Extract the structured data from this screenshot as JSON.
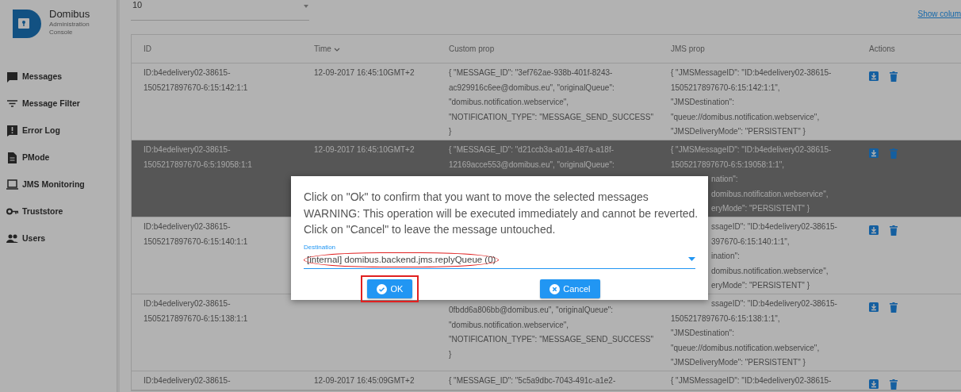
{
  "app": {
    "title": "Domibus",
    "subtitle_lines": [
      "Administration",
      "Console"
    ]
  },
  "sidebar": {
    "items": [
      {
        "label": "Messages",
        "kind": "chat"
      },
      {
        "label": "Message Filter",
        "kind": "filter"
      },
      {
        "label": "Error Log",
        "kind": "alert"
      },
      {
        "label": "PMode",
        "kind": "file"
      },
      {
        "label": "JMS Monitoring",
        "kind": "monitor"
      },
      {
        "label": "Truststore",
        "kind": "key"
      },
      {
        "label": "Users",
        "kind": "people"
      }
    ]
  },
  "page_size": {
    "value": "10"
  },
  "show_columns_link": "Show colum",
  "table": {
    "columns": [
      {
        "label": "ID",
        "sorted": false
      },
      {
        "label": "Time",
        "sorted": true
      },
      {
        "label": "Custom prop",
        "sorted": false
      },
      {
        "label": "JMS prop",
        "sorted": false
      },
      {
        "label": "Actions",
        "sorted": false
      }
    ],
    "rows": [
      {
        "selected": false,
        "id": [
          "ID:b4edelivery02-38615-",
          "1505217897670-6:15:142:1:1"
        ],
        "time": [
          "12-09-2017 16:45:10GMT+2"
        ],
        "custom": [
          "{ \"MESSAGE_ID\": \"3ef762ae-938b-401f-8243-",
          "ac929916c6ee@domibus.eu\", \"originalQueue\":",
          "\"domibus.notification.webservice\",",
          "\"NOTIFICATION_TYPE\": \"MESSAGE_SEND_SUCCESS\"",
          "}"
        ],
        "jms": [
          "{ \"JMSMessageID\": \"ID:b4edelivery02-38615-",
          "1505217897670-6:15:142:1:1\",",
          "\"JMSDestination\":",
          "\"queue://domibus.notification.webservice\",",
          "\"JMSDeliveryMode\": \"PERSISTENT\" }"
        ]
      },
      {
        "selected": true,
        "id": [
          "ID:b4edelivery02-38615-",
          "1505217897670-6:5:19058:1:1"
        ],
        "time": [
          "12-09-2017 16:45:10GMT+2"
        ],
        "custom": [
          "{ \"MESSAGE_ID\": \"d21ccb3a-a01a-487a-a18f-",
          "12169acce553@domibus.eu\", \"originalQueue\":"
        ],
        "jms": [
          "{ \"JMSMessageID\": \"ID:b4edelivery02-38615-",
          "1505217897670-6:5:19058:1:1\",",
          "nation\":",
          "domibus.notification.webservice\",",
          "eryMode\": \"PERSISTENT\" }"
        ]
      },
      {
        "selected": false,
        "id": [
          "ID:b4edelivery02-38615-",
          "1505217897670-6:15:140:1:1"
        ],
        "jms": [
          "ssageID\": \"ID:b4edelivery02-38615-",
          "397670-6:15:140:1:1\",",
          "ination\":",
          "domibus.notification.webservice\",",
          "eryMode\": \"PERSISTENT\" }"
        ]
      },
      {
        "selected": false,
        "id": [
          "ID:b4edelivery02-38615-",
          "1505217897670-6:15:138:1:1"
        ],
        "custom": [
          "0fbdd6a806bb@domibus.eu\", \"originalQueue\":",
          "\"domibus.notification.webservice\",",
          "\"NOTIFICATION_TYPE\": \"MESSAGE_SEND_SUCCESS\"",
          "}"
        ],
        "jms": [
          "ssageID\": \"ID:b4edelivery02-38615-",
          "1505217897670-6:15:138:1:1\",",
          "\"JMSDestination\":",
          "\"queue://domibus.notification.webservice\",",
          "\"JMSDeliveryMode\": \"PERSISTENT\" }"
        ]
      },
      {
        "selected": false,
        "id": [
          "ID:b4edelivery02-38615-"
        ],
        "time": [
          "12-09-2017 16:45:09GMT+2"
        ],
        "custom": [
          "{ \"MESSAGE_ID\": \"5c5a9dbc-7043-491c-a1e2-"
        ],
        "jms": [
          "{ \"JMSMessageID\": \"ID:b4edelivery02-38615-"
        ]
      }
    ]
  },
  "dialog": {
    "message_lines": [
      "Click on \"Ok\" to confirm that you want to move the selected messages",
      "WARNING: This operation will be executed immediately and cannot be reverted.",
      "Click on \"Cancel\" to leave the message untouched."
    ],
    "destination": {
      "label": "Destination",
      "value": "[internal] domibus.backend.jms.replyQueue (0)",
      "highlighted": true
    },
    "buttons": [
      {
        "label": "OK",
        "kind": "ok",
        "highlighted": true
      },
      {
        "label": "Cancel",
        "kind": "cancel",
        "highlighted": false
      }
    ]
  }
}
